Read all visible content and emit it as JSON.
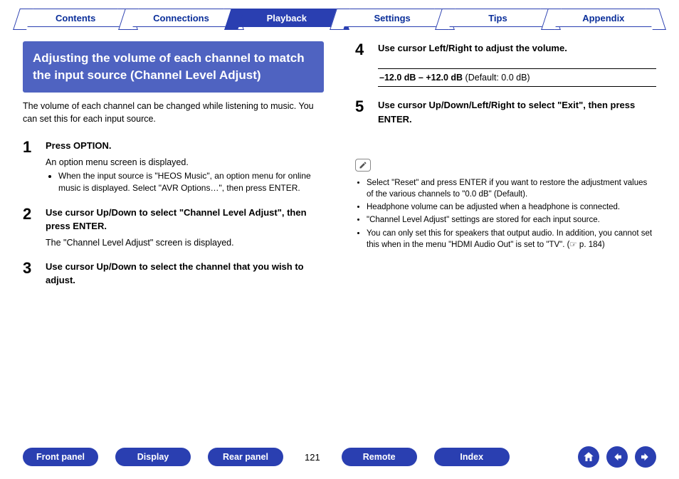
{
  "top_tabs": {
    "items": [
      {
        "label": "Contents"
      },
      {
        "label": "Connections"
      },
      {
        "label": "Playback"
      },
      {
        "label": "Settings"
      },
      {
        "label": "Tips"
      },
      {
        "label": "Appendix"
      }
    ],
    "active_index": 2
  },
  "left": {
    "heading": "Adjusting the volume of each channel to match the input source (Channel Level Adjust)",
    "intro": "The volume of each channel can be changed while listening to music. You can set this for each input source.",
    "steps": [
      {
        "num": "1",
        "title": "Press OPTION.",
        "desc": "An option menu screen is displayed.",
        "bullets": [
          "When the input source is \"HEOS Music\", an option menu for online music is displayed. Select \"AVR Options…\", then press ENTER."
        ]
      },
      {
        "num": "2",
        "title": "Use cursor Up/Down to select \"Channel Level Adjust\", then press ENTER.",
        "desc": "The \"Channel Level Adjust\" screen is displayed."
      },
      {
        "num": "3",
        "title": "Use cursor Up/Down to select the channel that you wish to adjust."
      }
    ]
  },
  "right": {
    "steps": [
      {
        "num": "4",
        "title": "Use cursor Left/Right to adjust the volume.",
        "range_bold": "–12.0 dB – +12.0 dB",
        "range_rest": " (Default: 0.0 dB)"
      },
      {
        "num": "5",
        "title": "Use cursor Up/Down/Left/Right to select \"Exit\", then press ENTER."
      }
    ],
    "notes": [
      "Select \"Reset\" and press ENTER if you want to restore the adjustment values of the various channels to \"0.0 dB\" (Default).",
      "Headphone volume can be adjusted when a headphone is connected.",
      "\"Channel Level Adjust\" settings are stored for each input source.",
      "You can only set this for speakers that output audio. In addition, you cannot set this when in the menu \"HDMI Audio Out\" is set to \"TV\".  (☞ p. 184)"
    ]
  },
  "bottom": {
    "buttons": [
      "Front panel",
      "Display",
      "Rear panel"
    ],
    "page_number": "121",
    "buttons2": [
      "Remote",
      "Index"
    ]
  }
}
